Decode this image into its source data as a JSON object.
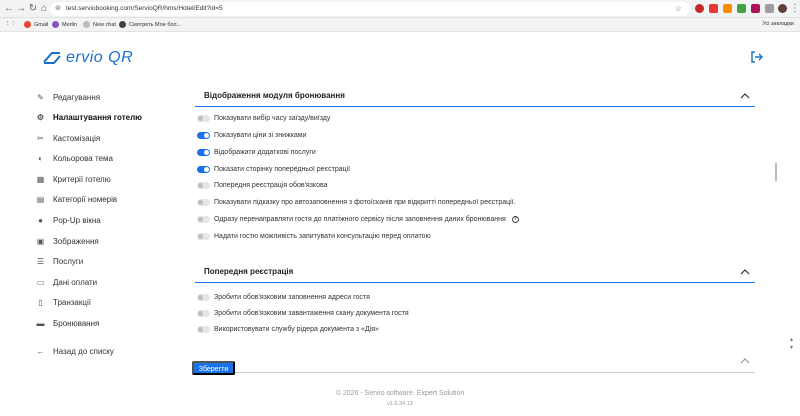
{
  "browser": {
    "url": "test.serviobooking.com/ServioQR/hms/Hotel/Edit?id=5",
    "bookmarks": [
      "Gmail",
      "Merlin",
      "New chat",
      "Смотреть  Мое бол..."
    ],
    "bookmarks_right": "Усі закладки"
  },
  "app": {
    "logo_text": "ervio QR",
    "brand_color": "#1a72c9",
    "accent_color": "#1a72e8"
  },
  "sidebar": {
    "items": [
      {
        "label": "Редагування",
        "icon": "pencil-icon"
      },
      {
        "label": "Налаштування готелю",
        "icon": "gear-icon",
        "active": true
      },
      {
        "label": "Кастомізація",
        "icon": "tools-icon"
      },
      {
        "label": "Кольорова тема",
        "icon": "palette-icon"
      },
      {
        "label": "Критерії готелю",
        "icon": "calendar-icon"
      },
      {
        "label": "Категорії номерів",
        "icon": "grid-icon"
      },
      {
        "label": "Pop-Up вікна",
        "icon": "chat-icon"
      },
      {
        "label": "Зображення",
        "icon": "image-icon"
      },
      {
        "label": "Послуги",
        "icon": "list-icon"
      },
      {
        "label": "Дані оплати",
        "icon": "card-icon"
      },
      {
        "label": "Транзакції",
        "icon": "receipt-icon"
      },
      {
        "label": "Бронювання",
        "icon": "bed-icon"
      }
    ],
    "back_label": "Назад до списку"
  },
  "section1": {
    "title": "Відображення модуля бронювання",
    "options": [
      {
        "label": "Показувати вибір часу заїзду/виїзду",
        "on": false
      },
      {
        "label": "Показувати ціни зі знижками",
        "on": true
      },
      {
        "label": "Відображати додаткові послуги",
        "on": true
      },
      {
        "label": "Показати сторінку попередньої реєстрації",
        "on": true
      },
      {
        "label": "Попередня реєстрація обов'язкова",
        "on": false
      },
      {
        "label": "Показувати підказку про автозаповнення з фото/сканів при відкритті попередньої реєстрації.",
        "on": false
      },
      {
        "label": "Одразу перенаправляти гостя до платіжного сервісу після заповнення даних бронювання",
        "on": false,
        "help": "?"
      },
      {
        "label": "Надати гостю можливість запитувати консультацію перед оплатою",
        "on": false
      }
    ]
  },
  "section2": {
    "title": "Попередня реєстрація",
    "options": [
      {
        "label": "Зробити обов'язковим заповнення адреси гостя",
        "on": false
      },
      {
        "label": "Зробити обов'язковим завантаження скану документа гостя",
        "on": false
      },
      {
        "label": "Використовувати службу рідера документа з «Дія»",
        "on": false
      }
    ]
  },
  "save_label": "Зберегти",
  "footer": {
    "copyright": "© 2026 - Servio software. Expert Solution",
    "version": "v1.5.34.13"
  }
}
